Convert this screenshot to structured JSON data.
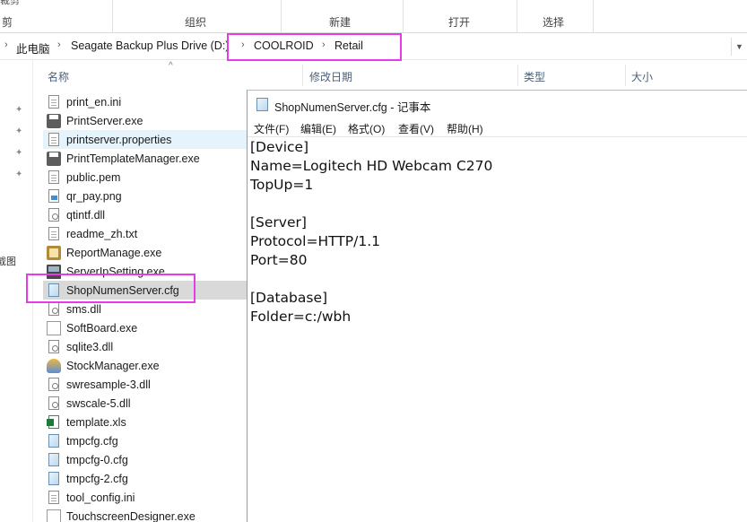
{
  "ribbon": {
    "clipboard_label": "剪贴板",
    "organize_label": "组织",
    "new_label": "新建",
    "open_label": "打开",
    "select_label": "选择",
    "clipped_top_left": "裁剪"
  },
  "address": {
    "crumbs": [
      "此电脑",
      "Seagate Backup Plus Drive (D:)",
      "COOLROID",
      "Retail"
    ],
    "dropdown_icon": "chevron-down-icon"
  },
  "columns": {
    "name": "名称",
    "modified": "修改日期",
    "type": "类型",
    "size": "大小"
  },
  "nav": {
    "fragment_label": "截图"
  },
  "files": [
    {
      "name": "print_en.ini",
      "icon": "document-icon"
    },
    {
      "name": "PrintServer.exe",
      "icon": "printer-icon"
    },
    {
      "name": "printserver.properties",
      "icon": "document-icon",
      "state": "hover"
    },
    {
      "name": "PrintTemplateManager.exe",
      "icon": "printer-icon"
    },
    {
      "name": "public.pem",
      "icon": "document-icon"
    },
    {
      "name": "qr_pay.png",
      "icon": "image-icon"
    },
    {
      "name": "qtintf.dll",
      "icon": "dll-icon"
    },
    {
      "name": "readme_zh.txt",
      "icon": "document-icon"
    },
    {
      "name": "ReportManage.exe",
      "icon": "report-app-icon"
    },
    {
      "name": "ServerIpSetting.exe",
      "icon": "settings-app-icon"
    },
    {
      "name": "ShopNumenServer.cfg",
      "icon": "config-icon",
      "state": "selected"
    },
    {
      "name": "sms.dll",
      "icon": "dll-icon"
    },
    {
      "name": "SoftBoard.exe",
      "icon": "app-icon"
    },
    {
      "name": "sqlite3.dll",
      "icon": "dll-icon"
    },
    {
      "name": "StockManager.exe",
      "icon": "stock-app-icon"
    },
    {
      "name": "swresample-3.dll",
      "icon": "dll-icon"
    },
    {
      "name": "swscale-5.dll",
      "icon": "dll-icon"
    },
    {
      "name": "template.xls",
      "icon": "excel-icon"
    },
    {
      "name": "tmpcfg.cfg",
      "icon": "config-icon"
    },
    {
      "name": "tmpcfg-0.cfg",
      "icon": "config-icon"
    },
    {
      "name": "tmpcfg-2.cfg",
      "icon": "config-icon"
    },
    {
      "name": "tool_config.ini",
      "icon": "document-icon"
    },
    {
      "name": "TouchscreenDesigner.exe",
      "icon": "app-icon"
    }
  ],
  "notepad": {
    "title": "ShopNumenServer.cfg - 记事本",
    "menu": [
      "文件(F)",
      "编辑(E)",
      "格式(O)",
      "查看(V)",
      "帮助(H)"
    ],
    "lines": [
      "[Device]",
      "Name=Logitech HD Webcam C270",
      "TopUp=1",
      "",
      "[Server]",
      "Protocol=HTTP/1.1",
      "Port=80",
      "",
      "[Database]",
      "Folder=c:/wbh"
    ]
  },
  "colors": {
    "highlight": "#e83be8",
    "hover_row": "#e5f3fb",
    "selected_row": "#d9d9d9"
  }
}
